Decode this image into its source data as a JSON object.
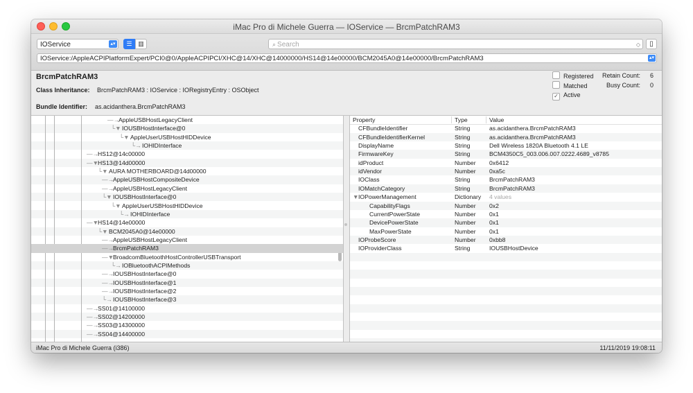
{
  "window": {
    "title": "iMac Pro di Michele Guerra — IOService — BrcmPatchRAM3"
  },
  "toolbar": {
    "plane": "IOService",
    "search_placeholder": "Search",
    "path": "IOService:/AppleACPIPlatformExpert/PCI0@0/AppleACPIPCI/XHC@14/XHC@14000000/HS14@14e00000/BCM2045A0@14e00000/BrcmPatchRAM3"
  },
  "info": {
    "class_name": "BrcmPatchRAM3",
    "inheritance_label": "Class Inheritance:",
    "inheritance_value": "BrcmPatchRAM3 : IOService : IORegistryEntry : OSObject",
    "bundle_label": "Bundle Identifier:",
    "bundle_value": "as.acidanthera.BrcmPatchRAM3",
    "registered_label": "Registered",
    "matched_label": "Matched",
    "active_label": "Active",
    "retain_label": "Retain Count:",
    "retain_value": "6",
    "busy_label": "Busy Count:",
    "busy_value": "0"
  },
  "tree": [
    {
      "prefix": "—→",
      "label": "AppleUSBHostLegacyClient"
    },
    {
      "prefix": "└▼",
      "label": "IOUSBHostInterface@0"
    },
    {
      "prefix": "└▼",
      "label": "AppleUserUSBHostHIDDevice"
    },
    {
      "prefix": "└→",
      "label": "IOHIDInterface"
    },
    {
      "prefix": "—→",
      "label": "HS12@14c00000"
    },
    {
      "prefix": "—▼",
      "label": "HS13@14d00000"
    },
    {
      "prefix": "└▼",
      "label": "AURA MOTHERBOARD@14d00000"
    },
    {
      "prefix": "—→",
      "label": "AppleUSBHostCompositeDevice"
    },
    {
      "prefix": "—→",
      "label": "AppleUSBHostLegacyClient"
    },
    {
      "prefix": "└▼",
      "label": "IOUSBHostInterface@0"
    },
    {
      "prefix": "└▼",
      "label": "AppleUserUSBHostHIDDevice"
    },
    {
      "prefix": "└→",
      "label": "IOHIDInterface"
    },
    {
      "prefix": "—▼",
      "label": "HS14@14e00000"
    },
    {
      "prefix": "└▼",
      "label": "BCM2045A0@14e00000"
    },
    {
      "prefix": "—→",
      "label": "AppleUSBHostLegacyClient"
    },
    {
      "prefix": "—→",
      "label": "BrcmPatchRAM3"
    },
    {
      "prefix": "—▼",
      "label": "BroadcomBluetoothHostControllerUSBTransport"
    },
    {
      "prefix": "└→",
      "label": "IOBluetoothACPIMethods"
    },
    {
      "prefix": "—→",
      "label": "IOUSBHostInterface@0"
    },
    {
      "prefix": "—→",
      "label": "IOUSBHostInterface@1"
    },
    {
      "prefix": "—→",
      "label": "IOUSBHostInterface@2"
    },
    {
      "prefix": "└→",
      "label": "IOUSBHostInterface@3"
    },
    {
      "prefix": "—→",
      "label": "SS01@14100000"
    },
    {
      "prefix": "—→",
      "label": "SS02@14200000"
    },
    {
      "prefix": "—→",
      "label": "SS03@14300000"
    },
    {
      "prefix": "—→",
      "label": "SS04@14400000"
    }
  ],
  "properties": {
    "headers": [
      "Property",
      "Type",
      "Value"
    ],
    "rows": [
      {
        "property": "CFBundleIdentifier",
        "type": "String",
        "value": "as.acidanthera.BrcmPatchRAM3"
      },
      {
        "property": "CFBundleIdentifierKernel",
        "type": "String",
        "value": "as.acidanthera.BrcmPatchRAM3"
      },
      {
        "property": "DisplayName",
        "type": "String",
        "value": "Dell Wireless 1820A Bluetooth 4.1 LE"
      },
      {
        "property": "FirmwareKey",
        "type": "String",
        "value": "BCM4350C5_003.006.007.0222.4689_v8785"
      },
      {
        "property": "idProduct",
        "type": "Number",
        "value": "0x6412"
      },
      {
        "property": "idVendor",
        "type": "Number",
        "value": "0xa5c"
      },
      {
        "property": "IOClass",
        "type": "String",
        "value": "BrcmPatchRAM3"
      },
      {
        "property": "IOMatchCategory",
        "type": "String",
        "value": "BrcmPatchRAM3"
      },
      {
        "property": "IOPowerManagement",
        "type": "Dictionary",
        "value": "4 values"
      },
      {
        "property": "CapabilityFlags",
        "type": "Number",
        "value": "0x2"
      },
      {
        "property": "CurrentPowerState",
        "type": "Number",
        "value": "0x1"
      },
      {
        "property": "DevicePowerState",
        "type": "Number",
        "value": "0x1"
      },
      {
        "property": "MaxPowerState",
        "type": "Number",
        "value": "0x1"
      },
      {
        "property": "IOProbeScore",
        "type": "Number",
        "value": "0xbb8"
      },
      {
        "property": "IOProviderClass",
        "type": "String",
        "value": "IOUSBHostDevice"
      }
    ]
  },
  "status": {
    "left": "iMac Pro di Michele Guerra (i386)",
    "right": "11/11/2019 19:08:11"
  },
  "colors": {
    "accent": "#2f7cf6",
    "selection": "#d3d3d3",
    "stripe": "#f4f5f5"
  }
}
